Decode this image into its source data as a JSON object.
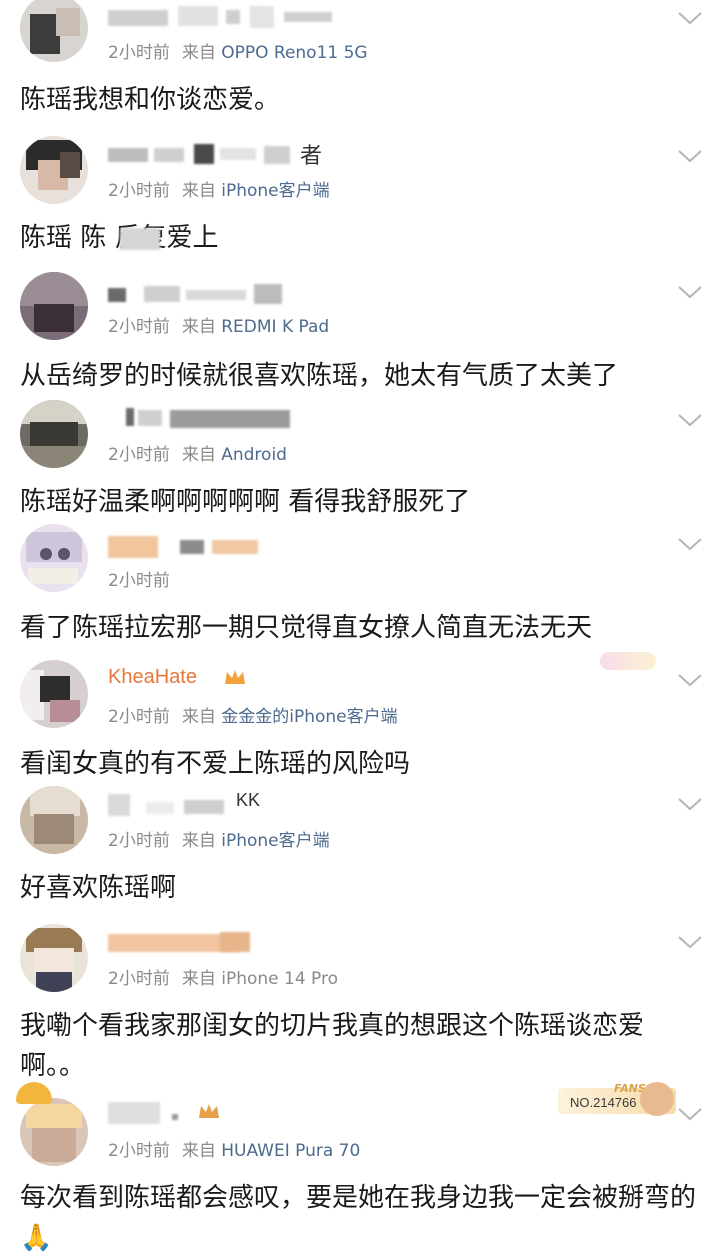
{
  "comments": [
    {
      "name_visible": "",
      "time": "2小时前",
      "from": "来自",
      "device": "OPPO Reno11 5G",
      "text": "陈瑶我想和你谈恋爱。"
    },
    {
      "name_visible": "者",
      "time": "2小时前",
      "from": "来自",
      "device": "iPhone客户端",
      "text": "陈瑶 陈 反复爱上"
    },
    {
      "name_visible": "",
      "time": "2小时前",
      "from": "来自",
      "device": "REDMI K Pad",
      "text": "从岳绮罗的时候就很喜欢陈瑶，她太有气质了太美了"
    },
    {
      "name_visible": "",
      "time": "2小时前",
      "from": "来自",
      "device": "Android",
      "text": "陈瑶好温柔啊啊啊啊啊 看得我舒服死了"
    },
    {
      "name_visible": "",
      "time": "2小时前",
      "from": "",
      "device": "",
      "text": "看了陈瑶拉宏那一期只觉得直女撩人简直无法无天"
    },
    {
      "name_visible": "KheaHate",
      "time": "2小时前",
      "from": "来自",
      "device": "金金金的iPhone客户端",
      "text": "看闺女真的有不爱上陈瑶的风险吗"
    },
    {
      "name_visible": "KK",
      "time": "2小时前",
      "from": "来自",
      "device": "iPhone客户端",
      "text": "好喜欢陈瑶啊"
    },
    {
      "name_visible": "",
      "time": "2小时前",
      "from": "来自",
      "device": "iPhone 14 Pro",
      "text": "我嘞个看我家那闺女的切片我真的想跟这个陈瑶谈恋爱啊。。"
    },
    {
      "name_visible": "",
      "time": "2小时前",
      "from": "来自",
      "device": "HUAWEI Pura 70",
      "text": "每次看到陈瑶都会感叹，要是她在我身边我一定会被掰弯的🙏",
      "fans_label": "FANS",
      "fans_no": "NO.214766"
    }
  ],
  "colors": {
    "device_link": "#4d6a8f",
    "meta_gray": "#8a8a8a",
    "username_vip": "#e6773a"
  },
  "icons": {
    "collapse": "chevron-down-icon",
    "vip": "crown-icon"
  }
}
